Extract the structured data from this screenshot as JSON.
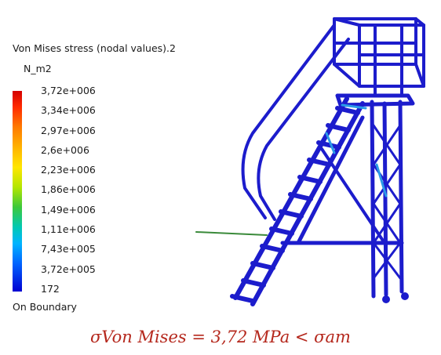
{
  "legend": {
    "title": "Von Mises stress (nodal values).2",
    "unit": "N_m2",
    "ticks": [
      "3,72e+006",
      "3,34e+006",
      "2,97e+006",
      "2,6e+006",
      "2,23e+006",
      "1,86e+006",
      "1,49e+006",
      "1,11e+006",
      "7,43e+005",
      "3,72e+005",
      "172"
    ],
    "footer": "On Boundary"
  },
  "caption": "σVon Mises = 3,72 MPa < σam",
  "colors": {
    "structure": "#1c1ccc",
    "structure_hot": "#2a7ae0",
    "caption": "#b5281d"
  }
}
